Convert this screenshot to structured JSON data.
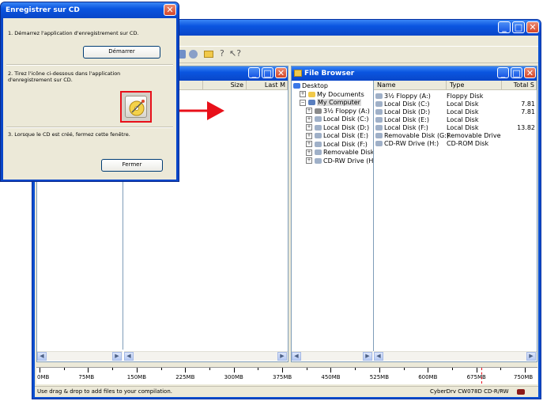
{
  "dialog": {
    "title": "Enregistrer sur CD",
    "step1": "1. Démarrez l'application d'enregistrement sur CD.",
    "start_button": "Démarrer",
    "step2_line1": "2. Tirez l'icône ci-dessous dans l'application",
    "step2_line2": "d'enregistrement sur CD.",
    "step3": "3. Lorsque le CD est créé, fermez cette fenêtre.",
    "close_button": "Fermer"
  },
  "compilation_pane": {
    "col_size": "Size",
    "col_last": "Last M"
  },
  "file_browser": {
    "title": "File Browser",
    "tree": [
      {
        "label": "Desktop",
        "level": 0
      },
      {
        "label": "My Documents",
        "level": 1
      },
      {
        "label": "My Computer",
        "level": 1
      },
      {
        "label": "3½ Floppy (A:)",
        "level": 2
      },
      {
        "label": "Local Disk (C:)",
        "level": 2
      },
      {
        "label": "Local Disk (D:)",
        "level": 2
      },
      {
        "label": "Local Disk (E:)",
        "level": 2
      },
      {
        "label": "Local Disk (F:)",
        "level": 2
      },
      {
        "label": "Removable Disk",
        "level": 2
      },
      {
        "label": "CD-RW Drive (H",
        "level": 2
      }
    ],
    "columns": [
      "Name",
      "Type",
      "Total S"
    ],
    "rows": [
      [
        "3½ Floppy (A:)",
        "Floppy Disk",
        ""
      ],
      [
        "Local Disk (C:)",
        "Local Disk",
        "7.81"
      ],
      [
        "Local Disk (D:)",
        "Local Disk",
        "7.81"
      ],
      [
        "Local Disk (E:)",
        "Local Disk",
        ""
      ],
      [
        "Local Disk (F:)",
        "Local Disk",
        "13.82"
      ],
      [
        "Removable Disk (G:)",
        "Removable Drive",
        ""
      ],
      [
        "CD-RW Drive (H:)",
        "CD-ROM Disk",
        ""
      ]
    ]
  },
  "ruler": [
    "0MB",
    "75MB",
    "150MB",
    "225MB",
    "300MB",
    "375MB",
    "450MB",
    "525MB",
    "600MB",
    "675MB",
    "750MB"
  ],
  "status": {
    "left": "Use drag & drop to add files to your compilation.",
    "right": "CyberDrv CW078D CD-R/RW"
  },
  "colors": {
    "titlebar": "#0a55e0",
    "arrow": "#e8101a",
    "highlight": "#e8101a"
  }
}
